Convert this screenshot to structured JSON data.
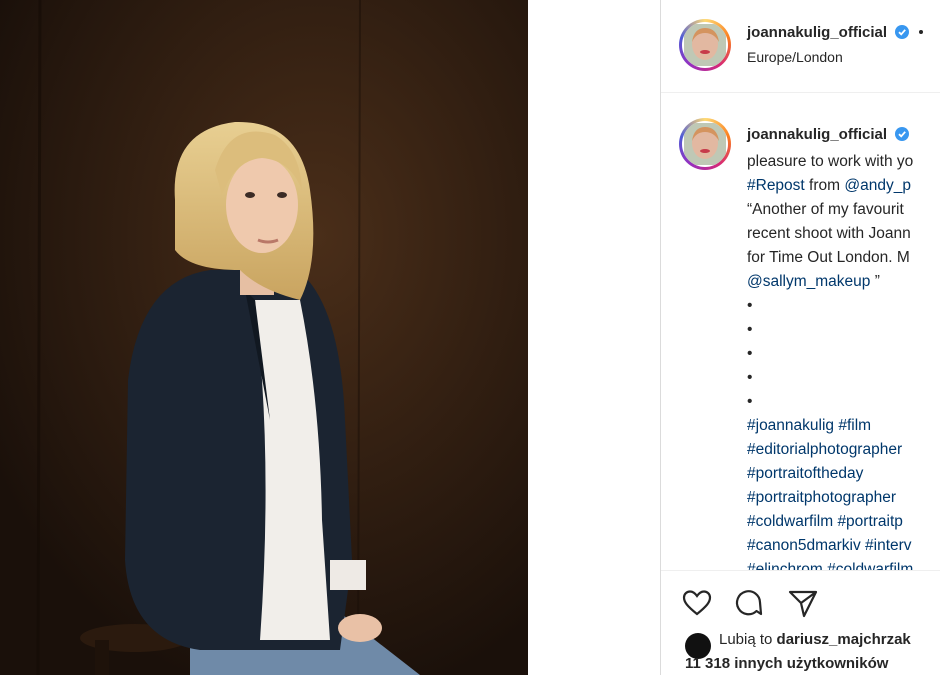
{
  "post": {
    "username": "joannakulig_official",
    "location": "Europe/London",
    "photo_alt": "portrait",
    "caption_lines": [
      {
        "prefix": "",
        "text": "pleasure to work with yo",
        "tag": false
      },
      {
        "prefix": "",
        "text": "#Repost",
        "tag": true,
        "suffix": " from ",
        "tag2": "@andy_p"
      },
      {
        "prefix": "",
        "text": "“Another of my favourit",
        "tag": false
      },
      {
        "prefix": "",
        "text": "recent shoot with Joann",
        "tag": false
      },
      {
        "prefix": "",
        "text": "for Time Out London. M",
        "tag": false
      },
      {
        "prefix": "",
        "text": "@sallym_makeup",
        "tag": true,
        "suffix": " ”"
      },
      {
        "prefix": "",
        "text": "•",
        "tag": false
      },
      {
        "prefix": "",
        "text": "•",
        "tag": false
      },
      {
        "prefix": "",
        "text": "•",
        "tag": false
      },
      {
        "prefix": "",
        "text": "•",
        "tag": false
      },
      {
        "prefix": "",
        "text": "•",
        "tag": false
      },
      {
        "prefix": "",
        "text": "#joannakulig #film",
        "tag": true
      },
      {
        "prefix": "",
        "text": "#editorialphotographer",
        "tag": true
      },
      {
        "prefix": "",
        "text": "#portraitoftheday",
        "tag": true
      },
      {
        "prefix": "",
        "text": "#portraitphotographer",
        "tag": true
      },
      {
        "prefix": "",
        "text": "#coldwarfilm #portraitp",
        "tag": true
      },
      {
        "prefix": "",
        "text": "#canon5dmarkiv #interv",
        "tag": true
      },
      {
        "prefix": "",
        "text": "#elinchrom #coldwarfilm",
        "tag": true
      }
    ]
  },
  "likes": {
    "prefix": "Lubią to ",
    "user": "dariusz_majchrzak",
    "count_line": "11 318 innych użytkowników"
  },
  "icons": {
    "like": "heart-icon",
    "comment": "comment-icon",
    "share": "paper-plane-icon",
    "verified": "verified-badge-icon"
  },
  "colors": {
    "link": "#00376b",
    "verified": "#3897f0",
    "text": "#262626"
  }
}
